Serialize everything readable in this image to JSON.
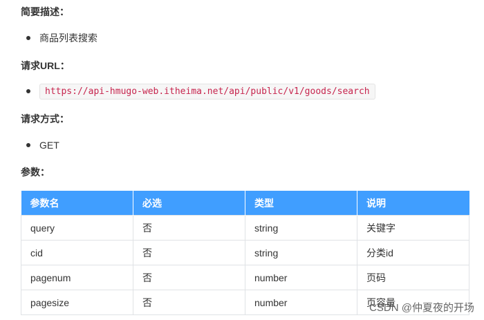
{
  "sections": {
    "description": {
      "heading": "简要描述：",
      "item": "商品列表搜索"
    },
    "url": {
      "heading": "请求URL：",
      "item": "https://api-hmugo-web.itheima.net/api/public/v1/goods/search"
    },
    "method": {
      "heading": "请求方式：",
      "item": "GET"
    },
    "params": {
      "heading": "参数："
    }
  },
  "table": {
    "headers": [
      "参数名",
      "必选",
      "类型",
      "说明"
    ],
    "rows": [
      [
        "query",
        "否",
        "string",
        "关键字"
      ],
      [
        "cid",
        "否",
        "string",
        "分类id"
      ],
      [
        "pagenum",
        "否",
        "number",
        "页码"
      ],
      [
        "pagesize",
        "否",
        "number",
        "页容量"
      ]
    ],
    "header_color": "#409eff"
  },
  "watermark": "CSDN @仲夏夜的开场"
}
